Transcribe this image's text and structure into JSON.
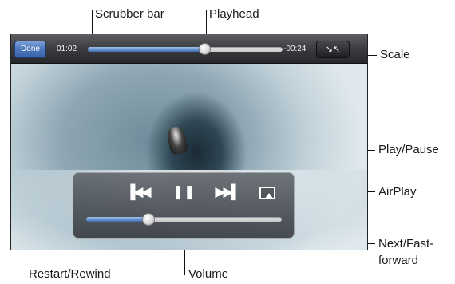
{
  "annotations": {
    "scrubber_bar": "Scrubber bar",
    "playhead": "Playhead",
    "scale": "Scale",
    "play_pause": "Play/Pause",
    "airplay": "AirPlay",
    "next_line1": "Next/Fast-",
    "next_line2": "forward",
    "restart_rewind": "Restart/Rewind",
    "volume": "Volume"
  },
  "player": {
    "done_label": "Done",
    "elapsed": "01:02",
    "remaining": "-00:24",
    "progress_fraction": 0.6,
    "volume_fraction": 0.32
  },
  "icons": {
    "rewind": "rewind-icon",
    "play_pause": "pause-icon",
    "next": "fast-forward-icon",
    "airplay": "airplay-icon",
    "scale": "scale-icon"
  },
  "colors": {
    "accent": "#3f6db5",
    "done_button": "#4a76bb",
    "bar_background": "#3a3c40"
  }
}
